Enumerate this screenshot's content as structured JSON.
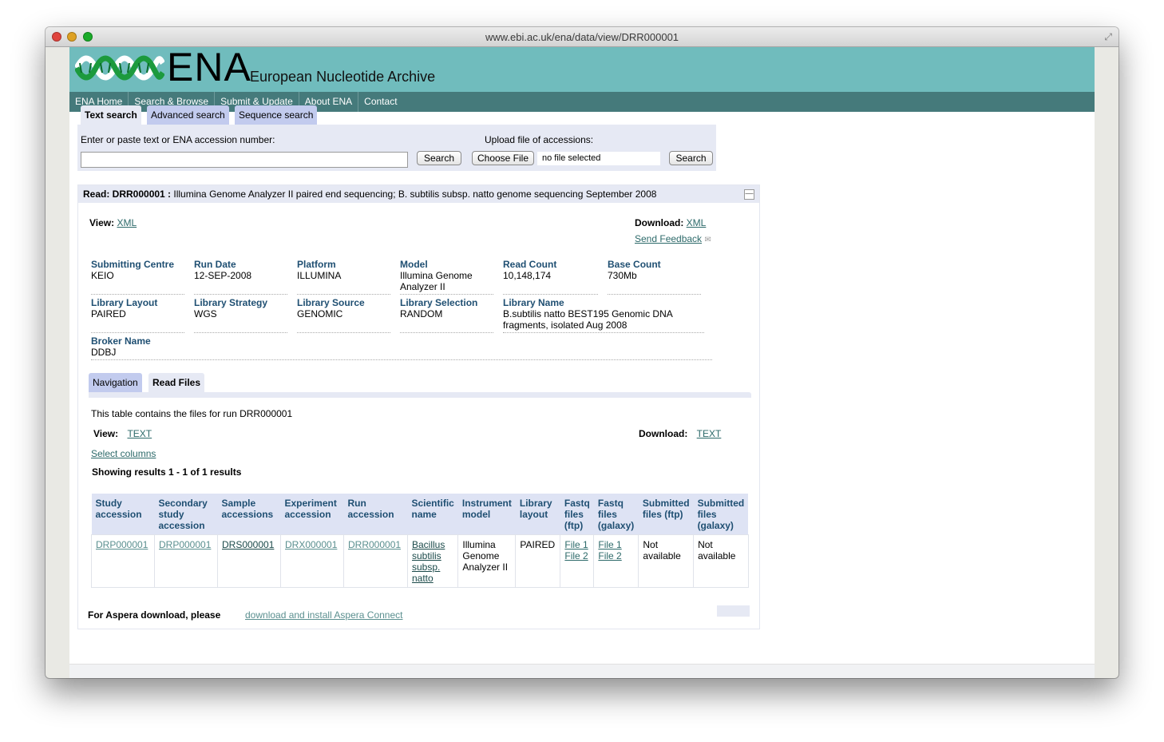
{
  "window": {
    "url": "www.ebi.ac.uk/ena/data/view/DRR000001"
  },
  "header": {
    "logo_text": "ENA",
    "logo_subtitle": "European Nucleotide Archive"
  },
  "nav": [
    "ENA Home",
    "Search & Browse",
    "Submit & Update",
    "About ENA",
    "Contact"
  ],
  "search_tabs": [
    "Text search",
    "Advanced search",
    "Sequence search"
  ],
  "search": {
    "text_label": "Enter or paste text or ENA accession number:",
    "text_value": "",
    "search_button": "Search",
    "upload_label": "Upload file of accessions:",
    "choose_file_button": "Choose File",
    "file_status": "no file selected",
    "upload_search_button": "Search"
  },
  "read": {
    "title_bold": "Read: DRR000001 :",
    "title_rest": " Illumina Genome Analyzer II paired end sequencing; B. subtilis subsp. natto genome sequencing September 2008",
    "view_label": "View:",
    "view_link": "XML",
    "download_label": "Download:",
    "download_link": "XML",
    "feedback_link": "Send Feedback",
    "fields": {
      "submitting_centre": {
        "label": "Submitting Centre",
        "value": "KEIO"
      },
      "run_date": {
        "label": "Run Date",
        "value": "12-SEP-2008"
      },
      "platform": {
        "label": "Platform",
        "value": "ILLUMINA"
      },
      "model": {
        "label": "Model",
        "value": "Illumina Genome Analyzer II"
      },
      "read_count": {
        "label": "Read Count",
        "value": "10,148,174"
      },
      "base_count": {
        "label": "Base Count",
        "value": "730Mb"
      },
      "library_layout": {
        "label": "Library Layout",
        "value": "PAIRED"
      },
      "library_strategy": {
        "label": "Library Strategy",
        "value": "WGS"
      },
      "library_source": {
        "label": "Library Source",
        "value": "GENOMIC"
      },
      "library_selection": {
        "label": "Library Selection",
        "value": "RANDOM"
      },
      "library_name": {
        "label": "Library Name",
        "value": "B.subtilis natto BEST195 Genomic DNA fragments, isolated Aug 2008"
      },
      "broker_name": {
        "label": "Broker Name",
        "value": "DDBJ"
      }
    }
  },
  "subtabs": [
    "Navigation",
    "Read Files"
  ],
  "files": {
    "intro": "This table contains the files for run DRR000001",
    "view_label": "View:",
    "view_link": "TEXT",
    "download_label": "Download:",
    "download_link": "TEXT",
    "select_columns": "Select columns",
    "results_text": "Showing results 1 - 1 of 1 results",
    "columns": [
      "Study accession",
      "Secondary study accession",
      "Sample accessions",
      "Experiment accession",
      "Run accession",
      "Scientific name",
      "Instrument model",
      "Library layout",
      "Fastq files (ftp)",
      "Fastq files (galaxy)",
      "Submitted files (ftp)",
      "Submitted files (galaxy)"
    ],
    "row": {
      "study": "DRP000001",
      "secondary_study": "DRP000001",
      "sample": "DRS000001",
      "experiment": "DRX000001",
      "run": "DRR000001",
      "scientific_name": "Bacillus subtilis subsp. natto",
      "instrument": "Illumina Genome Analyzer II",
      "layout": "PAIRED",
      "fastq_ftp": [
        "File 1",
        "File 2"
      ],
      "fastq_galaxy": [
        "File 1",
        "File 2"
      ],
      "submitted_ftp": "Not available",
      "submitted_galaxy": "Not available"
    },
    "aspera_label": "For Aspera download, please",
    "aspera_link": "download and install Aspera Connect"
  },
  "colors": {
    "masthead": "#70bcbd",
    "nav": "#457a7b",
    "panel": "#e6e9f4",
    "heading": "#1f4f72"
  }
}
